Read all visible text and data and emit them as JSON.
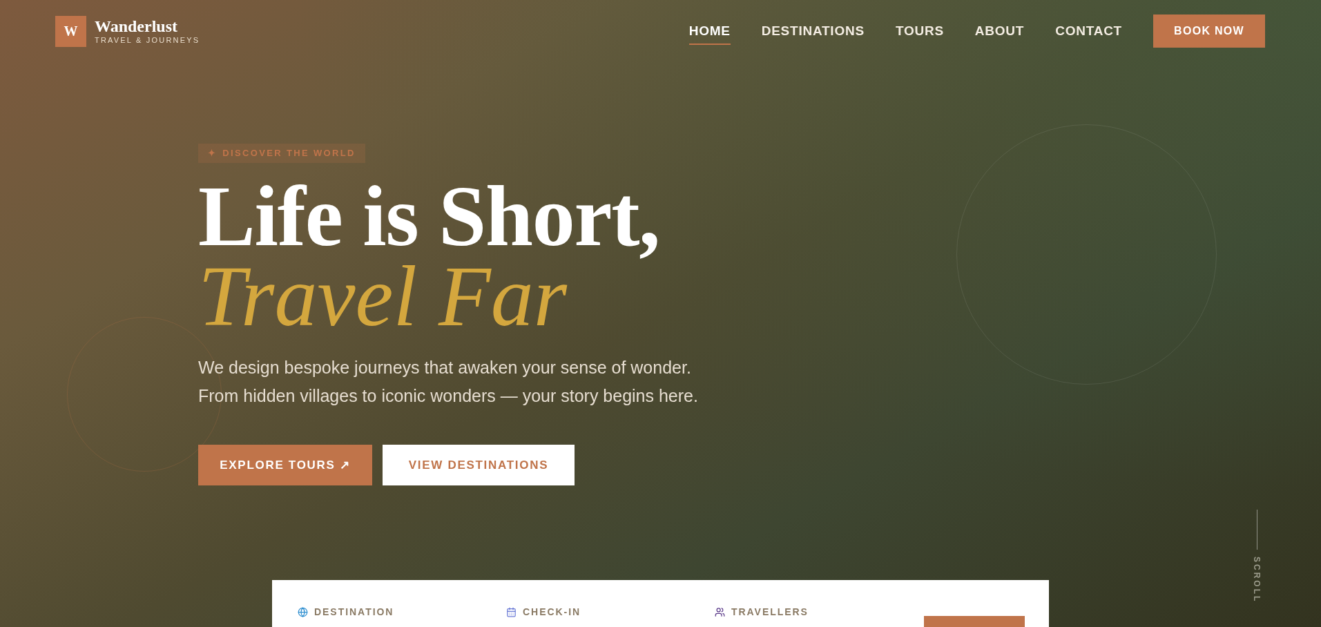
{
  "logo": {
    "mark": "W",
    "name": "Wanderlust",
    "tagline": "TRAVEL & JOURNEYS"
  },
  "nav": {
    "items": [
      {
        "label": "HOME",
        "selected": true
      },
      {
        "label": "DESTINATIONS",
        "selected": false
      },
      {
        "label": "TOURS",
        "selected": false
      },
      {
        "label": "ABOUT",
        "selected": false
      },
      {
        "label": "CONTACT",
        "selected": false
      }
    ],
    "cta": "BOOK NOW"
  },
  "hero": {
    "badge": {
      "icon": "✦",
      "text": "DISCOVER THE WORLD"
    },
    "title_line_1": "Life is Short,",
    "title_line_2": "Travel Far",
    "description": [
      "We design bespoke journeys that awaken your sense of wonder.",
      "From hidden villages to iconic wonders — your story begins here."
    ],
    "buttons": [
      {
        "label": "EXPLORE TOURS ↗",
        "kind": "primary"
      },
      {
        "label": "VIEW DESTINATIONS",
        "kind": "secondary"
      }
    ]
  },
  "booking": {
    "fields": [
      {
        "label": "DESTINATION",
        "kind": "destination"
      },
      {
        "label": "CHECK-IN",
        "kind": "date"
      },
      {
        "label": "TRAVELLERS",
        "kind": "guests"
      }
    ]
  },
  "scroll_hint": "SCROLL"
}
